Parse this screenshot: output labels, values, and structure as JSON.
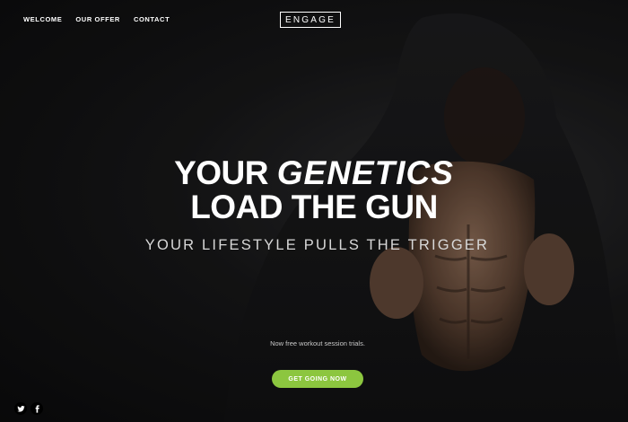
{
  "nav": {
    "items": [
      {
        "label": "WELCOME"
      },
      {
        "label": "OUR OFFER"
      },
      {
        "label": "CONTACT"
      }
    ]
  },
  "logo": {
    "text": "ENGAGE"
  },
  "hero": {
    "headline_line1_plain": "YOUR ",
    "headline_line1_emph": "GENETICS",
    "headline_line2": "LOAD THE GUN",
    "subheadline": "YOUR LIFESTYLE PULLS THE TRIGGER",
    "promo_text": "Now free workout session trials.",
    "cta_label": "GET GOING NOW"
  },
  "social": {
    "icons": [
      "twitter-icon",
      "facebook-icon"
    ]
  },
  "colors": {
    "accent": "#8cc63f",
    "background": "#0d0d0e"
  }
}
